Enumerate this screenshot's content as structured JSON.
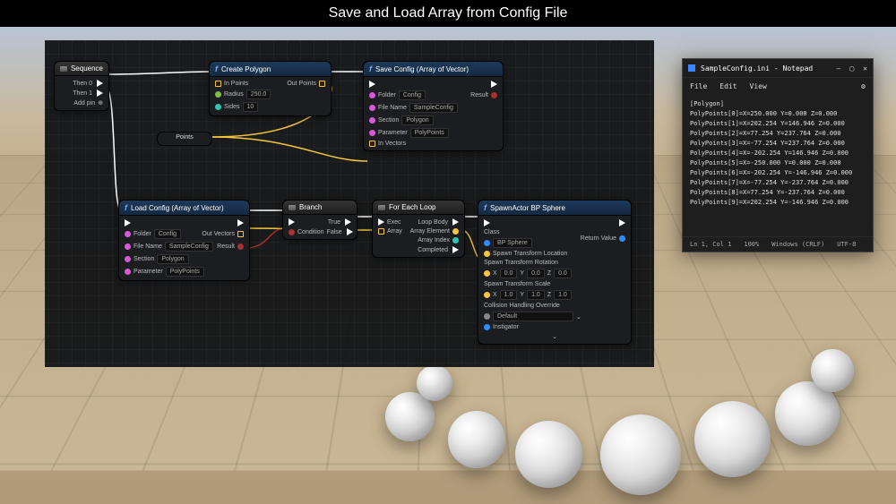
{
  "title": "Save and Load Array from Config File",
  "nodes": {
    "sequence": {
      "title": "Sequence",
      "out0": "Then 0",
      "out1": "Then 1",
      "addpin": "Add pin"
    },
    "createPolygon": {
      "title": "Create Polygon",
      "inPoints": "In Points",
      "radius_lbl": "Radius",
      "radius_val": "250.0",
      "sides_lbl": "Sides",
      "sides_val": "10",
      "outPoints": "Out Points"
    },
    "saveConfig": {
      "title": "Save Config (Array of Vector)",
      "folder_lbl": "Folder",
      "folder_val": "Config",
      "filename_lbl": "File Name",
      "filename_val": "SampleConfig",
      "section_lbl": "Section",
      "section_val": "Polygon",
      "param_lbl": "Parameter",
      "param_val": "PolyPoints",
      "inVectors": "In Vectors",
      "result": "Result"
    },
    "reroute": {
      "label": "Points"
    },
    "loadConfig": {
      "title": "Load Config (Array of Vector)",
      "folder_lbl": "Folder",
      "folder_val": "Config",
      "filename_lbl": "File Name",
      "filename_val": "SampleConfig",
      "section_lbl": "Section",
      "section_val": "Polygon",
      "param_lbl": "Parameter",
      "param_val": "PolyPoints",
      "outVectors": "Out Vectors",
      "result": "Result"
    },
    "branch": {
      "title": "Branch",
      "condition": "Condition",
      "true": "True",
      "false": "False"
    },
    "forEach": {
      "title": "For Each Loop",
      "exec": "Exec",
      "array": "Array",
      "loopBody": "Loop Body",
      "arrayElement": "Array Element",
      "arrayIndex": "Array Index",
      "completed": "Completed"
    },
    "spawn": {
      "title": "SpawnActor BP Sphere",
      "class_lbl": "Class",
      "class_val": "BP Sphere",
      "returnVal": "Return Value",
      "stl": "Spawn Transform Location",
      "str": "Spawn Transform Rotation",
      "str_x": "0.0",
      "str_y": "0.0",
      "str_z": "0.0",
      "sts": "Spawn Transform Scale",
      "sts_x": "1.0",
      "sts_y": "1.0",
      "sts_z": "1.0",
      "coll_lbl": "Collision Handling Override",
      "coll_val": "Default",
      "instigator": "Instigator"
    }
  },
  "notepad": {
    "title": "SampleConfig.ini - Notepad",
    "menu": {
      "file": "File",
      "edit": "Edit",
      "view": "View"
    },
    "content": "[Polygon]\nPolyPoints[0]=X=250.000 Y=0.000 Z=0.000\nPolyPoints[1]=X=202.254 Y=146.946 Z=0.000\nPolyPoints[2]=X=77.254 Y=237.764 Z=0.000\nPolyPoints[3]=X=-77.254 Y=237.764 Z=0.000\nPolyPoints[4]=X=-202.254 Y=146.946 Z=0.000\nPolyPoints[5]=X=-250.000 Y=0.000 Z=0.000\nPolyPoints[6]=X=-202.254 Y=-146.946 Z=0.000\nPolyPoints[7]=X=-77.254 Y=-237.764 Z=0.000\nPolyPoints[8]=X=77.254 Y=-237.764 Z=0.000\nPolyPoints[9]=X=202.254 Y=-146.946 Z=0.000",
    "status": {
      "pos": "Ln 1, Col 1",
      "zoom": "100%",
      "eol": "Windows (CRLF)",
      "enc": "UTF-8"
    }
  }
}
